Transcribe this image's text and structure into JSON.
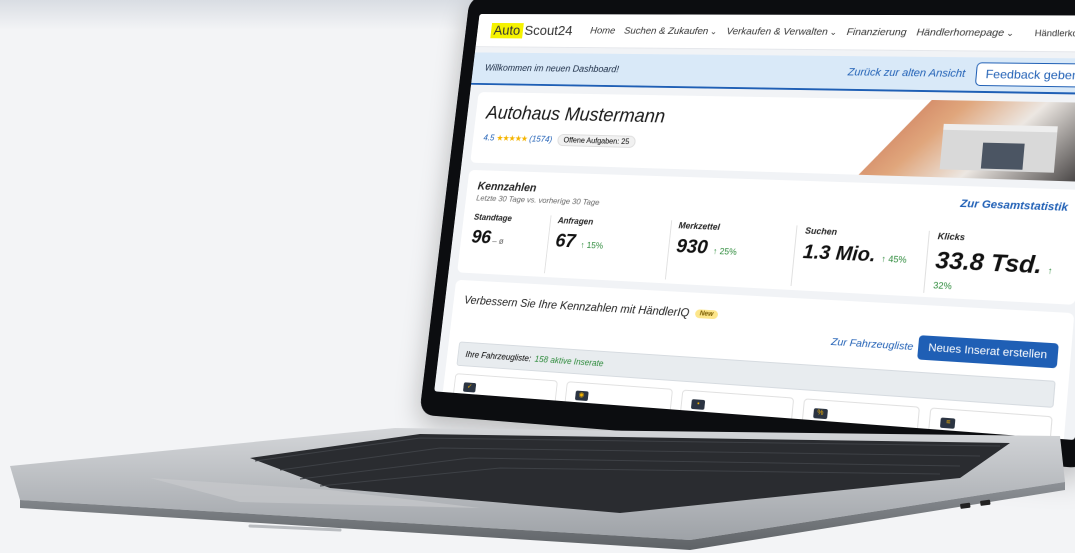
{
  "nav": {
    "logo_part1": "Auto",
    "logo_part2": "Scout24",
    "items": [
      {
        "label": "Home",
        "has_chevron": false
      },
      {
        "label": "Suchen & Zukaufen",
        "has_chevron": true
      },
      {
        "label": "Verkaufen & Verwalten",
        "has_chevron": true
      },
      {
        "label": "Finanzierung",
        "has_chevron": false
      },
      {
        "label": "Händlerhomepage",
        "has_chevron": true
      }
    ],
    "account": "Händlerkonto"
  },
  "welcome": {
    "text": "Willkommen im neuen Dashboard!",
    "back_link": "Zurück zur alten Ansicht",
    "feedback_button": "Feedback geben"
  },
  "dealer": {
    "name": "Autohaus Mustermann",
    "rating": "4.5",
    "stars": "★★★★★",
    "reviews": "(1574)",
    "open_tasks": "Offene Aufgaben: 25"
  },
  "kennzahlen": {
    "title": "Kennzahlen",
    "subtitle": "Letzte 30 Tage vs. vorherige 30 Tage",
    "link": "Zur Gesamtstatistik",
    "metrics": [
      {
        "label": "Standtage",
        "value": "96",
        "sub": "– ø",
        "delta": ""
      },
      {
        "label": "Anfragen",
        "value": "67",
        "sub": "",
        "delta": "↑ 15%"
      },
      {
        "label": "Merkzettel",
        "value": "930",
        "sub": "",
        "delta": "↑ 25%"
      },
      {
        "label": "Suchen",
        "value": "1.3 Mio.",
        "sub": "",
        "delta": "↑ 45%"
      },
      {
        "label": "Klicks",
        "value": "33.8 Tsd.",
        "sub": "",
        "delta": "↑ 32%"
      }
    ]
  },
  "improve": {
    "title": "Verbessern Sie Ihre Kennzahlen mit HändlerIQ",
    "badge": "New",
    "fahrzeug_link": "Zur Fahrzeugliste",
    "new_button": "Neues Inserat erstellen",
    "fahrzeug_label": "Ihre Fahrzeugliste:",
    "fahrzeug_count": "158 aktive Inserate"
  },
  "colors": {
    "accent": "#1f5fb5",
    "logo_yellow": "#f5f200",
    "positive": "#2c8a3a"
  }
}
